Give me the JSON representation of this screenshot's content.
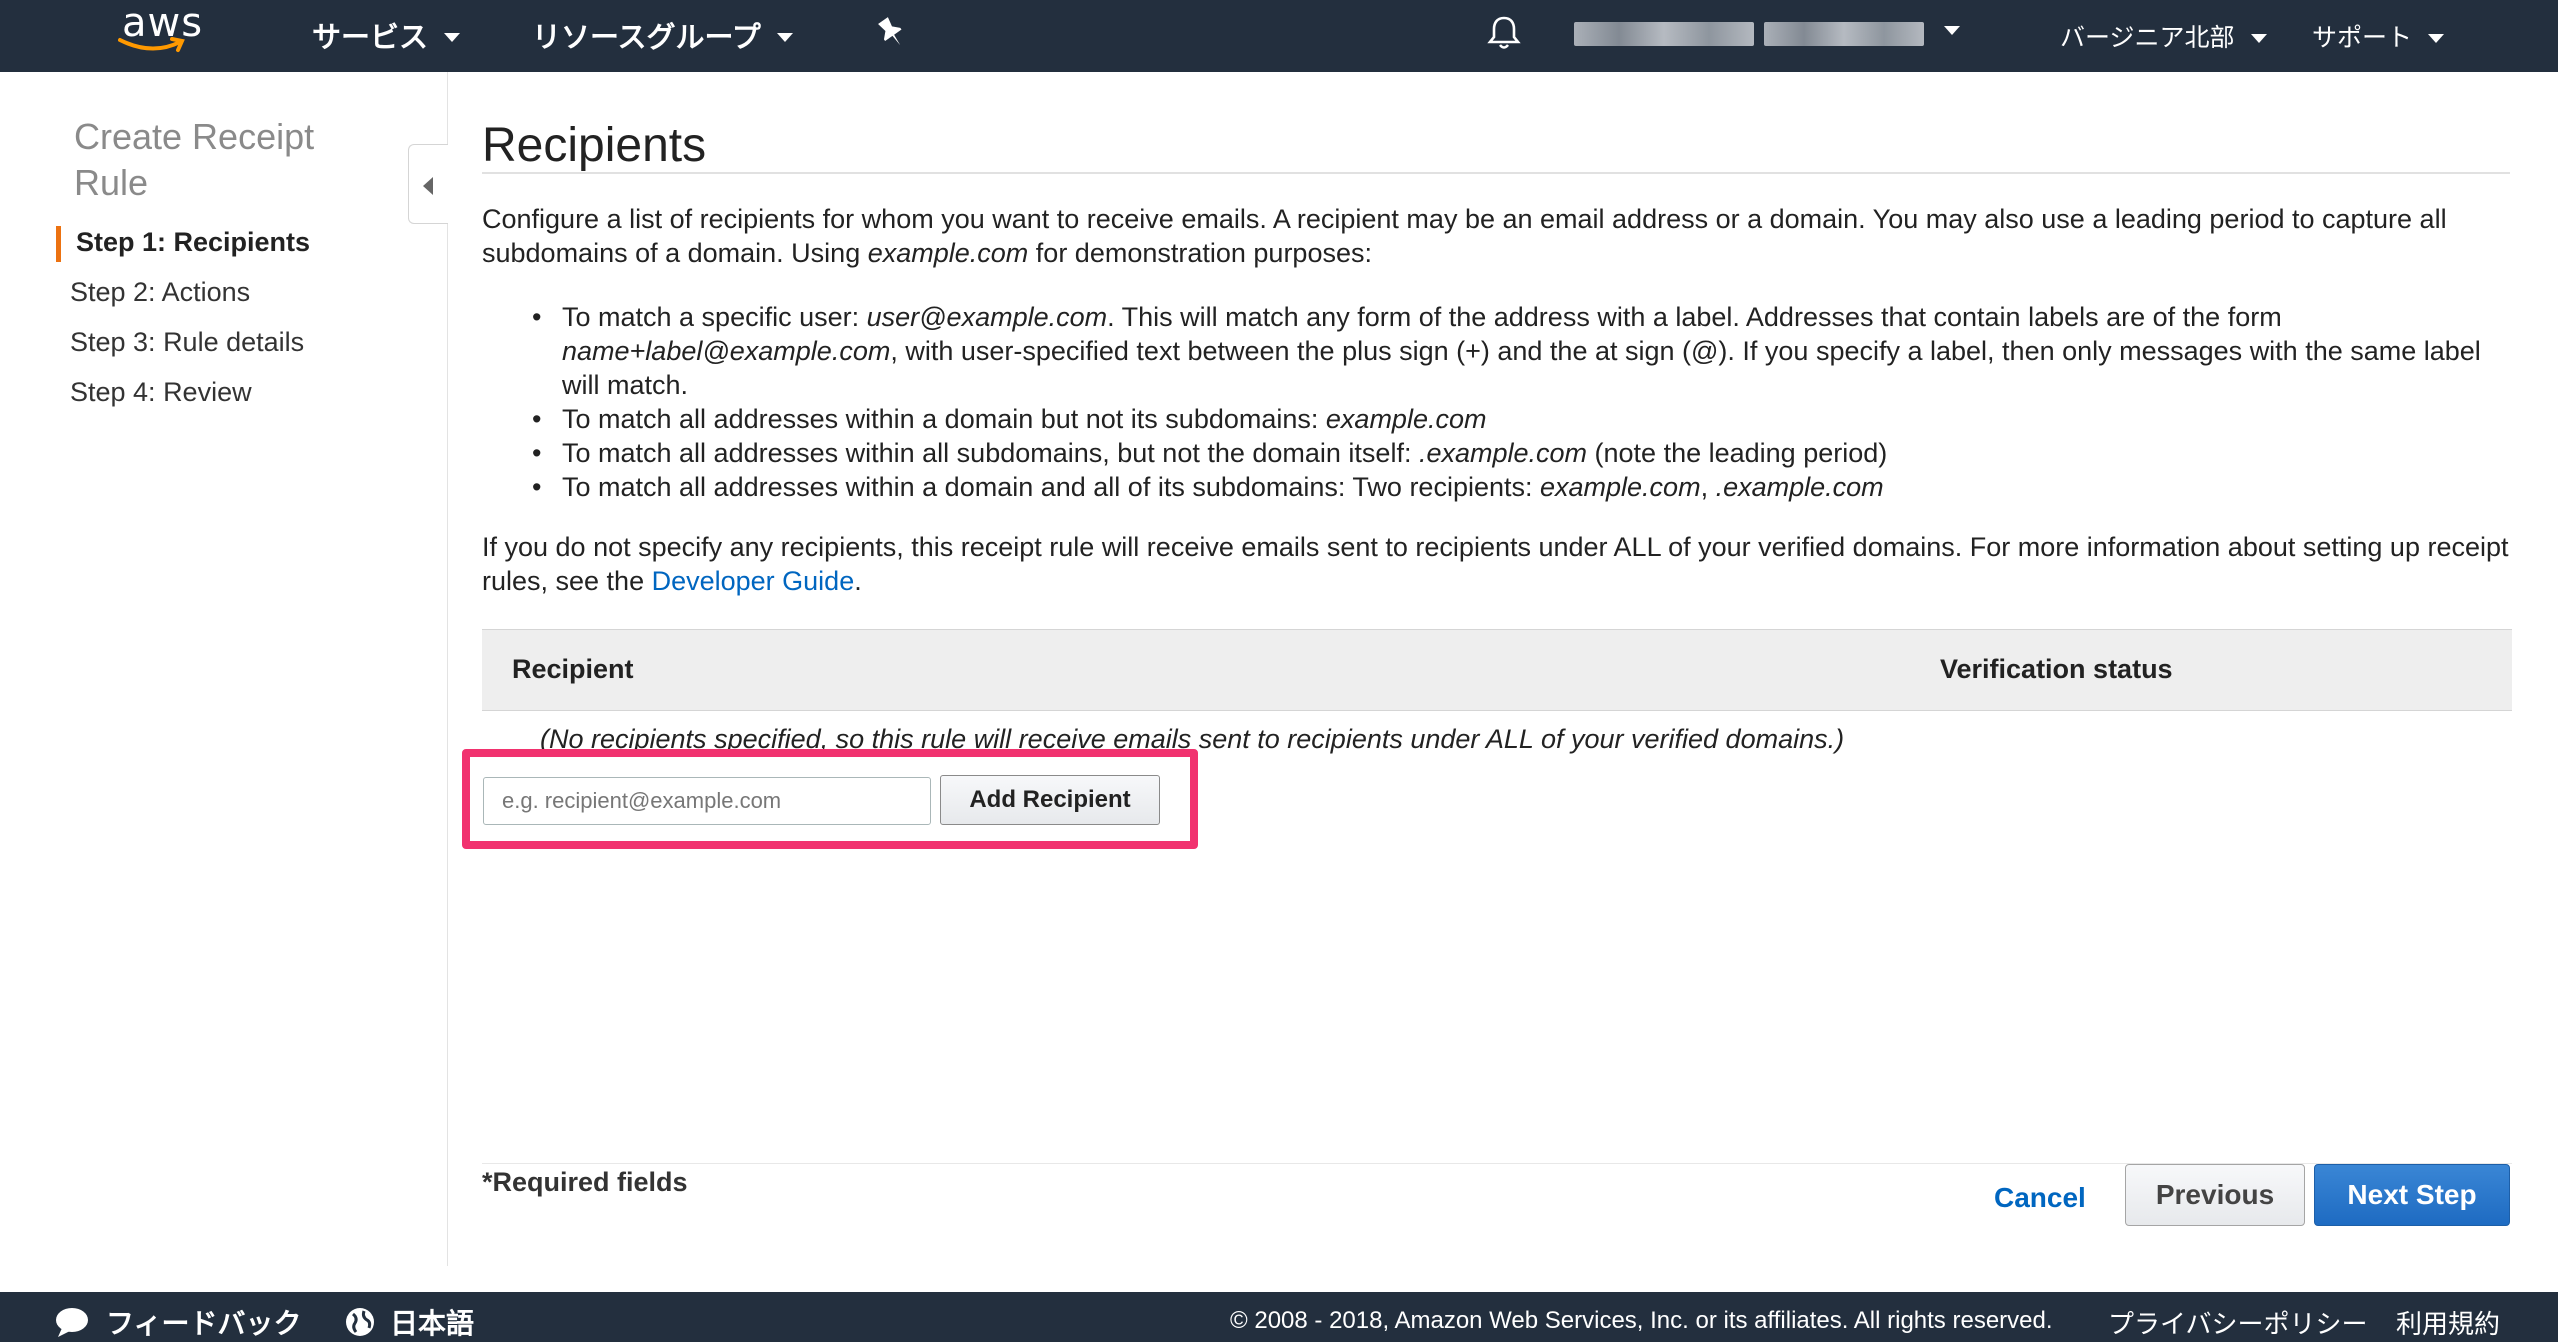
{
  "topnav": {
    "logo_text": "aws",
    "services_label": "サービス",
    "resource_groups_label": "リソースグループ",
    "region_label": "バージニア北部",
    "support_label": "サポート"
  },
  "sidebar": {
    "title": "Create Receipt Rule",
    "steps": [
      {
        "label": "Step 1: Recipients",
        "active": true
      },
      {
        "label": "Step 2: Actions",
        "active": false
      },
      {
        "label": "Step 3: Rule details",
        "active": false
      },
      {
        "label": "Step 4: Review",
        "active": false
      }
    ]
  },
  "main": {
    "title": "Recipients",
    "intro_part1": "Configure a list of recipients for whom you want to receive emails. A recipient may be an email address or a domain. You may also use a leading period to capture all subdomains of a domain. Using ",
    "intro_example": "example.com",
    "intro_part2": " for demonstration purposes:",
    "bullet1_a": "To match a specific user: ",
    "bullet1_em": "user@example.com",
    "bullet1_b": ". This will match any form of the address with a label. Addresses that contain labels are of the form ",
    "bullet1_em2": "name+label@example.com",
    "bullet1_c": ", with user-specified text between the plus sign (+) and the at sign (@). If you specify a label, then only messages with the same label will match.",
    "bullet2_a": "To match all addresses within a domain but not its subdomains: ",
    "bullet2_em": "example.com",
    "bullet3_a": "To match all addresses within all subdomains, but not the domain itself: ",
    "bullet3_em": ".example.com",
    "bullet3_b": " (note the leading period)",
    "bullet4_a": "To match all addresses within a domain and all of its subdomains: Two recipients: ",
    "bullet4_em": "example.com",
    "bullet4_sep": ", ",
    "bullet4_em2": ".example.com",
    "note_part1": "If you do not specify any recipients, this receipt rule will receive emails sent to recipients under ALL of your verified domains. For more information about setting up receipt rules, see the ",
    "note_link": "Developer Guide",
    "note_part2": ".",
    "table": {
      "col_recipient": "Recipient",
      "col_status": "Verification status",
      "empty_message": "(No recipients specified, so this rule will receive emails sent to recipients under ALL of your verified domains.)"
    },
    "recipient_input": {
      "value": "",
      "placeholder": "e.g. recipient@example.com"
    },
    "add_recipient_label": "Add Recipient",
    "required_note": "*Required fields",
    "cancel_label": "Cancel",
    "previous_label": "Previous",
    "next_label": "Next Step"
  },
  "footer": {
    "feedback_label": "フィードバック",
    "language_label": "日本語",
    "copyright": "© 2008 - 2018, Amazon Web Services, Inc. or its affiliates. All rights reserved.",
    "privacy_label": "プライバシーポリシー",
    "terms_label": "利用規約"
  },
  "colors": {
    "nav_bg": "#232f3e",
    "accent_orange": "#ec7211",
    "link_blue": "#0066c0",
    "primary_button": "#1e6bc2",
    "highlight_pink": "#f1326f"
  }
}
